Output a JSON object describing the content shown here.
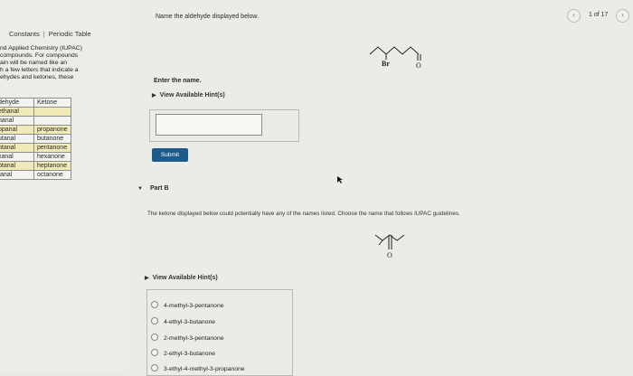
{
  "sidebar": {
    "tabs": [
      "Constants",
      "Periodic Table"
    ],
    "tab_separator": "|",
    "intro_lines": [
      "nd Applied Chemistry (IUPAC)",
      " compounds. For compounds",
      "ain will be named like an",
      "h a few letters that indicate a",
      "ehydes and ketones, these"
    ],
    "table": {
      "headers": [
        "dehyde",
        "Ketone"
      ],
      "rows": [
        [
          "ethanal",
          ""
        ],
        [
          "hanal",
          ""
        ],
        [
          "opanal",
          "propanone"
        ],
        [
          "utanal",
          "butanone"
        ],
        [
          "ntanal",
          "pentanone"
        ],
        [
          "xanal",
          "hexanone"
        ],
        [
          "otanal",
          "heptanone"
        ],
        [
          "tanal",
          "octanone"
        ]
      ]
    }
  },
  "header": {
    "question": "Name the aldehyde displayed below.",
    "counter": "1 of 17",
    "prev_icon": "chevron-left-icon",
    "next_icon": "chevron-right-icon"
  },
  "partA": {
    "structure_labels": [
      "Br",
      "O"
    ],
    "enter_label": "Enter the name.",
    "hint_label": "View Available Hint(s)",
    "answer_value": "",
    "submit_label": "Submit"
  },
  "partB": {
    "title": "Part B",
    "question": "The ketone displayed below could potentially have any of the names listed. Choose the name that follows IUPAC guidelines.",
    "structure_labels": [
      "O"
    ],
    "hint_label": "View Available Hint(s)",
    "options": [
      "4-methyl-3-pentanone",
      "4-ethyl-3-butanone",
      "2-methyl-3-pentanone",
      "2-ethyl-3-butanone",
      "3-ethyl-4-methyl-3-propanone"
    ]
  },
  "colors": {
    "submit_bg": "#1f5a8c",
    "highlight": "#f0eab6",
    "page_bg": "#ebebe8"
  }
}
